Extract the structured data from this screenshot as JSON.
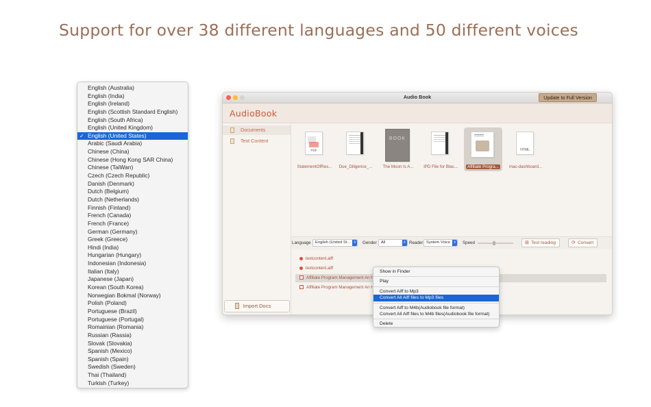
{
  "headline": "Support for over 38 different languages and 50 different voices",
  "language_menu": {
    "items": [
      "English (Australia)",
      "English (India)",
      "English (Ireland)",
      "English (Scottish Standard English)",
      "English (South Africa)",
      "English (United Kingdom)",
      "English (United States)",
      "Arabic (Saudi Arabia)",
      "Chinese (China)",
      "Chinese (Hong Kong SAR China)",
      "Chinese (TaiWan)",
      "Czech (Czech Republic)",
      "Danish (Denmark)",
      "Dutch (Belgium)",
      "Dutch (Netherlands)",
      "Finnish (Finland)",
      "French (Canada)",
      "French (France)",
      "German (Germany)",
      "Greek (Greece)",
      "Hindi (India)",
      "Hungarian (Hungary)",
      "Indonesian (Indonesia)",
      "Italian (Italy)",
      "Japanese (Japan)",
      "Korean (South Korea)",
      "Norwegian Bokmal (Norway)",
      "Polish (Poland)",
      "Portuguese (Brazil)",
      "Portuguese (Portugal)",
      "Romainian (Romania)",
      "Russian (Rassia)",
      "Slovak (Slovakia)",
      "Spanish (Mexico)",
      "Spanish (Spain)",
      "Swedish (Sweden)",
      "Thai (Thailand)",
      "Turkish (Turkey)"
    ],
    "selected_index": 6,
    "check_mark": "✓"
  },
  "window": {
    "title": "Audio Book",
    "update_button": "Update to Full Version",
    "logo": "AudioBook",
    "sidebar": {
      "items": [
        {
          "label": "Documents",
          "icon": "document-icon",
          "active": true
        },
        {
          "label": "Text Content",
          "icon": "text-content-icon",
          "active": false
        }
      ],
      "import_button": "Import Docs"
    },
    "documents": [
      {
        "name": "StatementOfRes...",
        "tag": "PDF",
        "selected": false
      },
      {
        "name": "Due_Diligence_...",
        "tag": "",
        "selected": false
      },
      {
        "name": "The Moon Is A...",
        "tag": "BOOK",
        "selected": false
      },
      {
        "name": "IPD File for Blac...",
        "tag": "",
        "selected": false
      },
      {
        "name": "Affiliate Progra...",
        "tag": "",
        "selected": true
      },
      {
        "name": "mac-dashboard...",
        "tag": "HTML",
        "selected": false
      }
    ],
    "controls": {
      "language_label": "Language",
      "language_value": "English (United St...",
      "gender_label": "Gender",
      "gender_value": "All",
      "reader_label": "Reader",
      "reader_value": "System Voice",
      "speed_label": "Speed",
      "speed_fraction": 0.45,
      "test_button": "Test reading",
      "convert_button": "Convert"
    },
    "files": [
      {
        "name": "textcontent.aiff",
        "type": "audio"
      },
      {
        "name": "textcontent.aiff",
        "type": "audio"
      },
      {
        "name": "Affiliate Program Management An H",
        "type": "document"
      },
      {
        "name": "Affiliate Program Management An H",
        "type": "document"
      }
    ]
  },
  "context_menu": {
    "groups": [
      [
        "Show in Finder"
      ],
      [
        "Play"
      ],
      [
        "Convert Aiff to Mp3",
        "Convert All Aiff files to Mp3 files"
      ],
      [
        "Convert Aiff to M4b(Audiobook file format)",
        "Convert All Aiff files to M4b files(Audiobook file format)"
      ],
      [
        "Delete"
      ]
    ],
    "selected": "Convert All Aiff files to Mp3 files"
  },
  "colors": {
    "headline": "#9b6f56",
    "logo": "#cd5a36",
    "selection": "#1b66d6",
    "accent": "#a8503a"
  }
}
